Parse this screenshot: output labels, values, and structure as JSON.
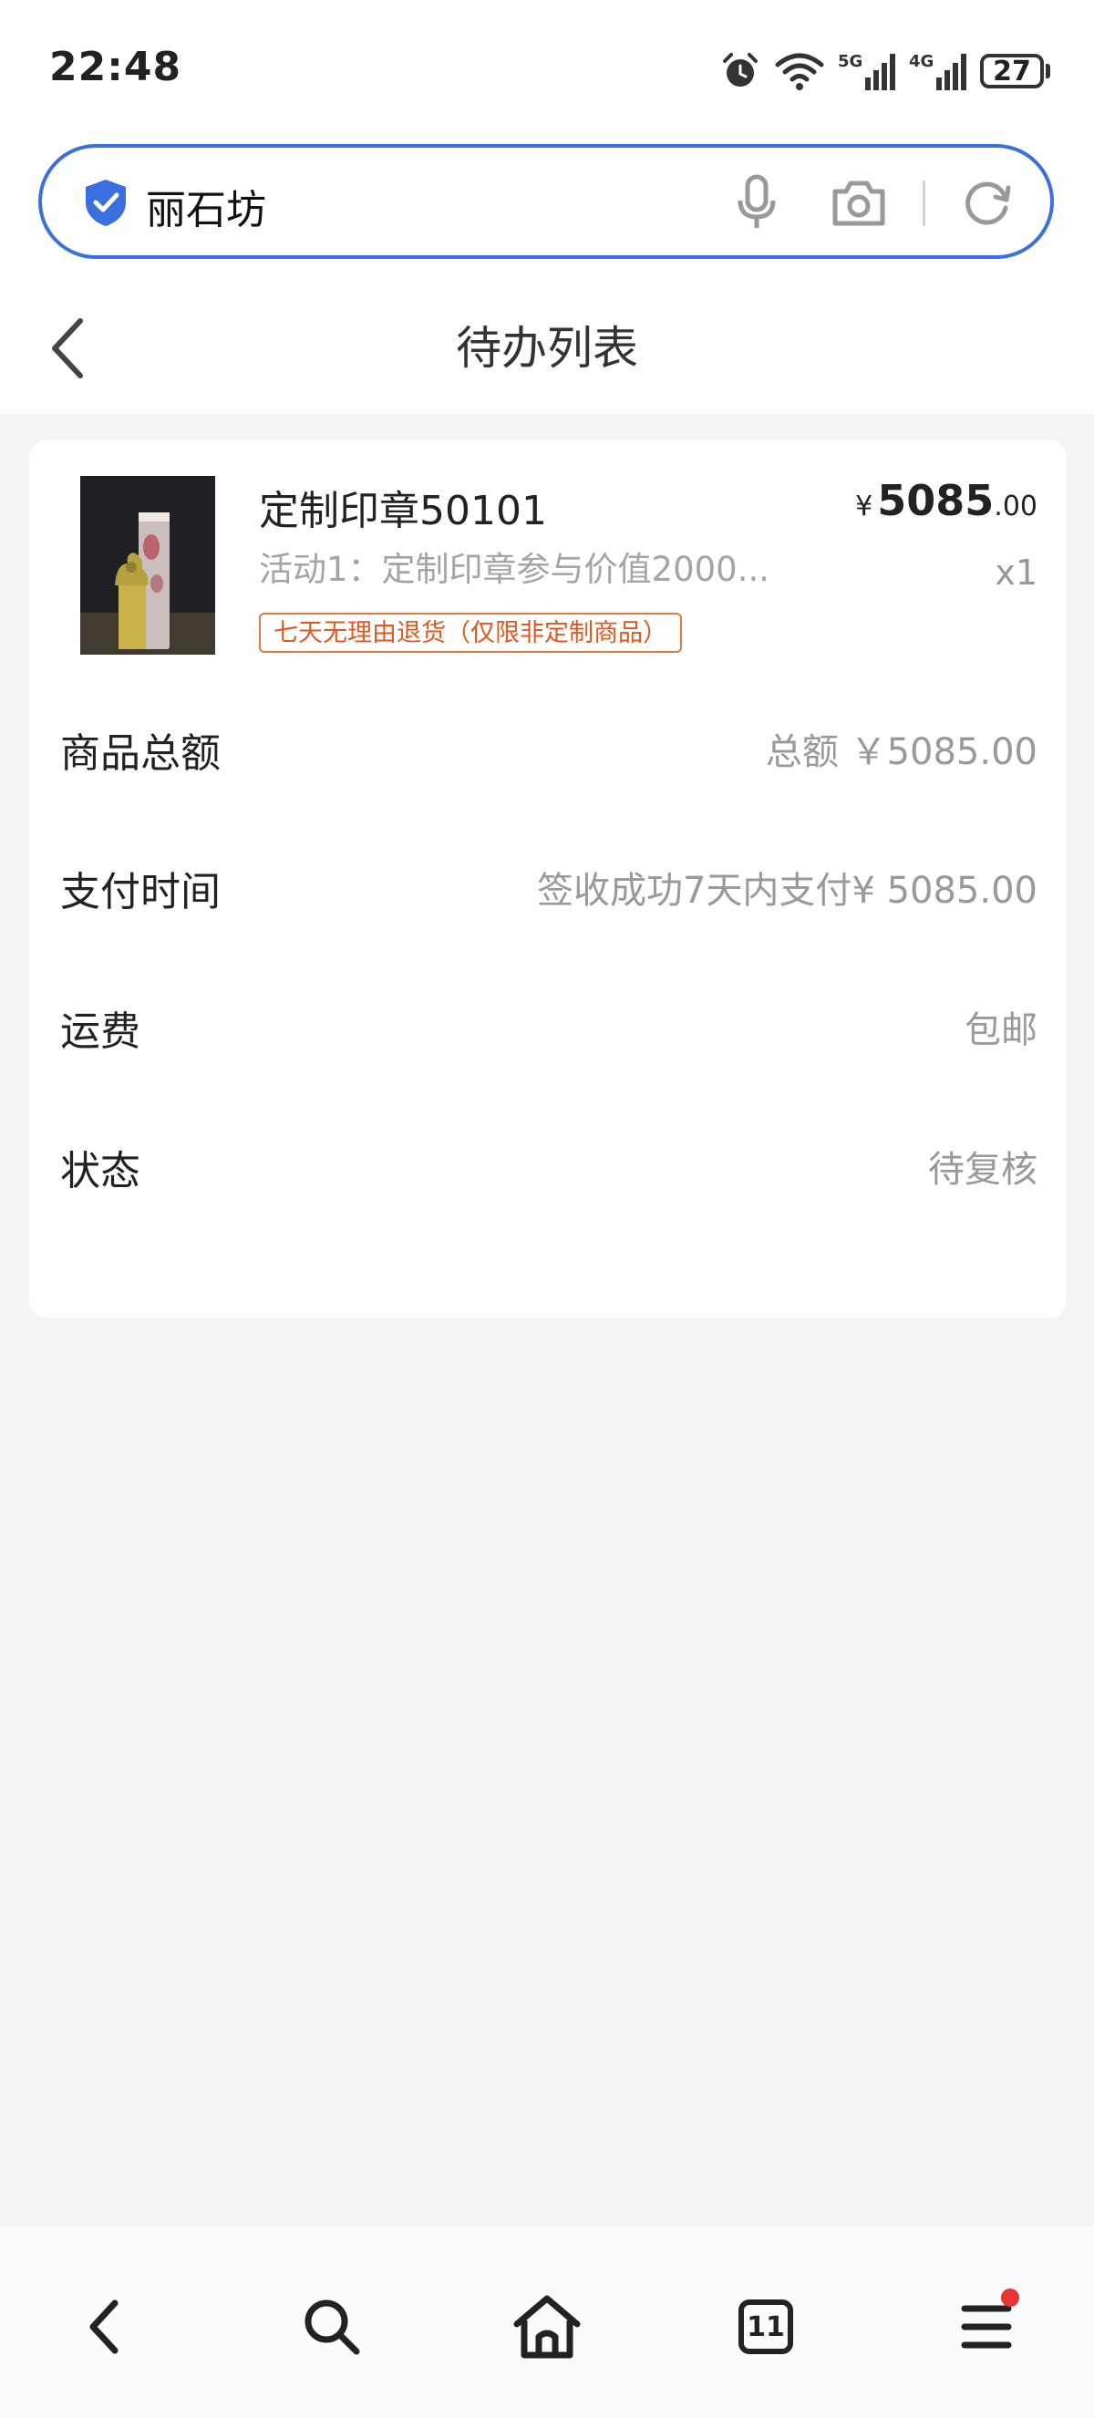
{
  "status_bar": {
    "time": "22:48",
    "battery": "27",
    "icons": [
      "alarm-icon",
      "wifi-icon",
      "signal-5g-icon",
      "signal-4g-icon",
      "battery-icon"
    ]
  },
  "search": {
    "query": "丽石坊",
    "icons": [
      "shield-icon",
      "microphone-icon",
      "camera-icon",
      "refresh-icon"
    ]
  },
  "header": {
    "title": "待办列表"
  },
  "order": {
    "product": {
      "name": "定制印章50101",
      "description": "活动1：定制印章参与价值2000...",
      "tag": "七天无理由退货（仅限非定制商品）",
      "price_currency": "¥",
      "price_integer": "5085",
      "price_decimal": ".00",
      "quantity": "x1"
    },
    "details": [
      {
        "label": "商品总额",
        "value": "总额 ￥5085.00"
      },
      {
        "label": "支付时间",
        "value": "签收成功7天内支付¥ 5085.00"
      },
      {
        "label": "运费",
        "value": "包邮"
      },
      {
        "label": "状态",
        "value": "待复核"
      }
    ]
  },
  "bottom_nav": {
    "tab_count": "11",
    "items": [
      "back-icon",
      "search-icon",
      "home-icon",
      "tabs-icon",
      "menu-icon"
    ]
  },
  "colors": {
    "accent": "#3a6fe0",
    "tag": "#e0591c",
    "badge": "#e63535",
    "background": "#f4f4f5"
  }
}
